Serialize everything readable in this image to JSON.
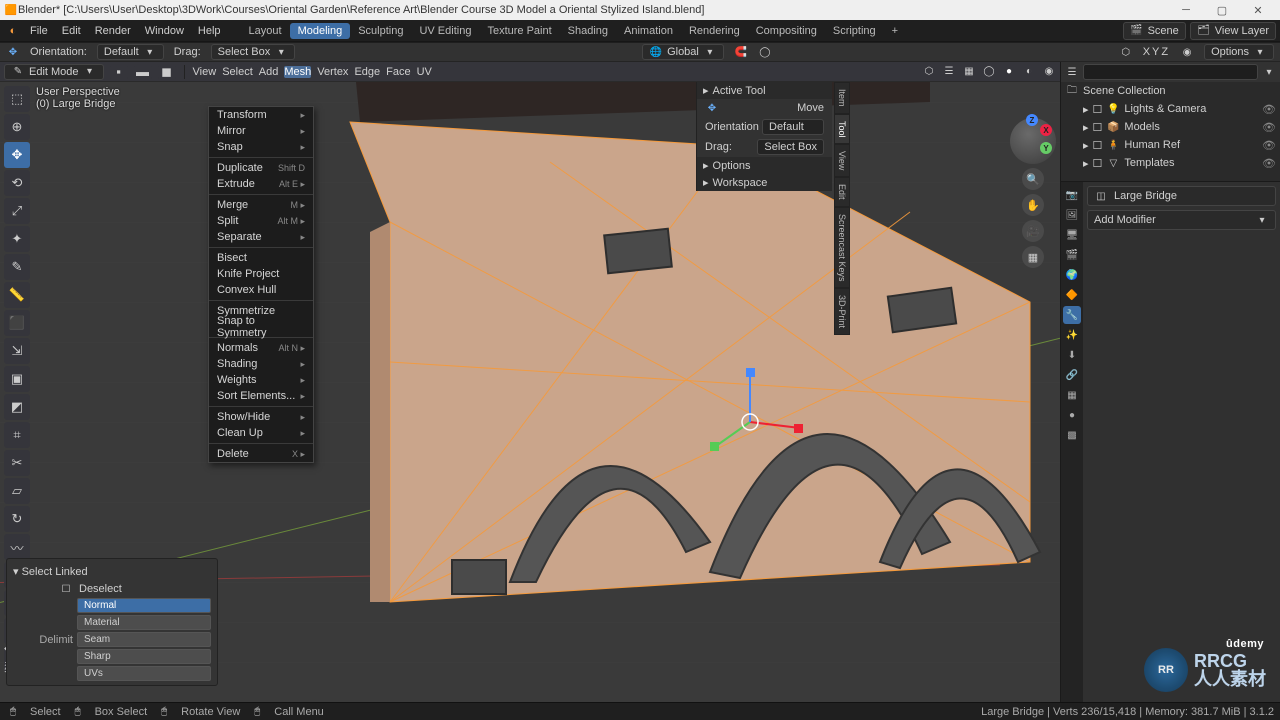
{
  "window": {
    "title": "Blender* [C:\\Users\\User\\Desktop\\3DWork\\Courses\\Oriental Garden\\Reference Art\\Blender Course 3D Model a Oriental Stylized Island.blend]"
  },
  "menubar": {
    "items": [
      "File",
      "Edit",
      "Render",
      "Window",
      "Help"
    ],
    "workspaces": [
      "Layout",
      "Modeling",
      "Sculpting",
      "UV Editing",
      "Texture Paint",
      "Shading",
      "Animation",
      "Rendering",
      "Compositing",
      "Scripting"
    ],
    "active_workspace": "Modeling",
    "scene_label": "Scene",
    "viewlayer_label": "View Layer"
  },
  "toolbar2": {
    "orientation_label": "Orientation:",
    "orientation_value": "Default",
    "drag_label": "Drag:",
    "drag_value": "Select Box",
    "transform_space": "Global",
    "options_label": "Options",
    "overlay_axes": "XYZ"
  },
  "vp_header": {
    "mode": "Edit Mode",
    "menus": [
      "View",
      "Select",
      "Add",
      "Mesh",
      "Vertex",
      "Edge",
      "Face",
      "UV"
    ],
    "open_menu": "Mesh"
  },
  "mesh_menu": {
    "items": [
      {
        "label": "Transform",
        "sub": true
      },
      {
        "label": "Mirror",
        "sub": true
      },
      {
        "label": "Snap",
        "sub": true
      },
      "-",
      {
        "label": "Duplicate",
        "hint": "Shift D"
      },
      {
        "label": "Extrude",
        "hint": "Alt E",
        "sub": true
      },
      "-",
      {
        "label": "Merge",
        "hint": "M",
        "sub": true
      },
      {
        "label": "Split",
        "hint": "Alt M",
        "sub": true
      },
      {
        "label": "Separate",
        "sub": true
      },
      "-",
      {
        "label": "Bisect"
      },
      {
        "label": "Knife Project"
      },
      {
        "label": "Convex Hull"
      },
      "-",
      {
        "label": "Symmetrize"
      },
      {
        "label": "Snap to Symmetry"
      },
      "-",
      {
        "label": "Normals",
        "hint": "Alt N",
        "sub": true
      },
      {
        "label": "Shading",
        "sub": true
      },
      {
        "label": "Weights",
        "sub": true
      },
      {
        "label": "Sort Elements...",
        "sub": true
      },
      "-",
      {
        "label": "Show/Hide",
        "sub": true
      },
      {
        "label": "Clean Up",
        "sub": true
      },
      "-",
      {
        "label": "Delete",
        "hint": "X",
        "sub": true
      }
    ]
  },
  "corner_info": {
    "line1": "User Perspective",
    "line2": "(0) Large Bridge"
  },
  "tool_icons": [
    "select-box",
    "cursor",
    "move",
    "rotate",
    "scale",
    "transform",
    "annotate",
    "measure",
    "add-cube",
    "extrude",
    "inset",
    "bevel",
    "loop-cut",
    "knife",
    "poly-build",
    "spin",
    "smooth",
    "edge-slide",
    "shrink",
    "shear",
    "rip"
  ],
  "active_tool": "move",
  "npanel": {
    "title": "Active Tool",
    "tool_name": "Move",
    "orientation_label": "Orientation",
    "orientation_value": "Default",
    "drag_label": "Drag:",
    "drag_value": "Select Box",
    "options": "Options",
    "workspace": "Workspace",
    "tabs": [
      "Item",
      "Tool",
      "View",
      "Edit",
      "Screencast Keys",
      "3D-Print"
    ]
  },
  "outliner": {
    "root": "Scene Collection",
    "items": [
      {
        "label": "Lights & Camera",
        "icon": "💡"
      },
      {
        "label": "Models",
        "icon": "📦"
      },
      {
        "label": "Human Ref",
        "icon": "🧍"
      },
      {
        "label": "Templates",
        "icon": "▽"
      }
    ]
  },
  "properties": {
    "breadcrumb_obj": "Large Bridge",
    "add_modifier": "Add Modifier",
    "tabs": [
      "render",
      "output",
      "view",
      "scene",
      "world",
      "object",
      "modifier",
      "particles",
      "physics",
      "constraint",
      "data",
      "material",
      "texture"
    ]
  },
  "select_linked": {
    "title": "Select Linked",
    "deselect": "Deselect",
    "delimit_label": "Delimit",
    "options": [
      "Normal",
      "Material",
      "Seam",
      "Sharp",
      "UVs"
    ],
    "active": "Normal"
  },
  "statusbar": {
    "left": [
      "Select",
      "Box Select",
      "Rotate View",
      "Call Menu"
    ],
    "right": "Large Bridge | Verts 236/15,418 | Memory: 381.7 MiB | 3.1.2"
  },
  "watermark": {
    "badge": "RR",
    "text": "RRCG\n人人素材"
  },
  "udemy": "ûdemy"
}
